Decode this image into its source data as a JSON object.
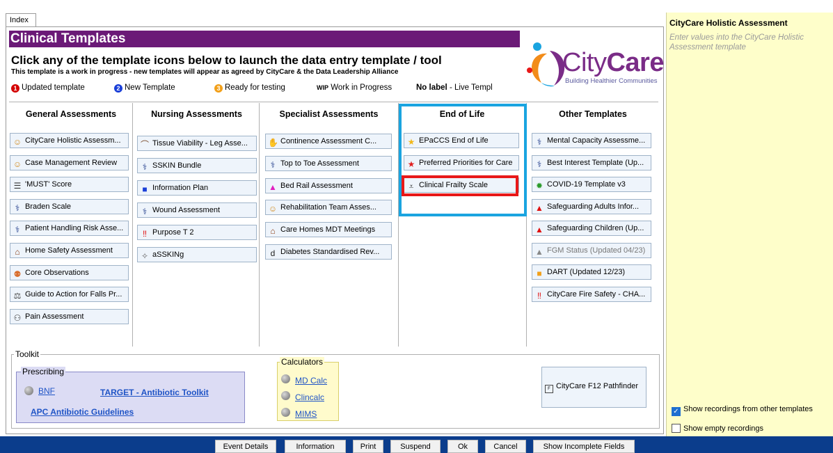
{
  "tab": {
    "label": "Index"
  },
  "header": {
    "title": "Clinical Templates",
    "subtitle": "Click any of the template icons below to launch the data entry template / tool",
    "wip_note": "This template is a work in progress - new templates will appear as agreed by CityCare & the Data Leadership Alliance"
  },
  "legend": {
    "updated": "Updated template",
    "updated_num": "1",
    "new": "New Template",
    "new_num": "2",
    "ready": "Ready for testing",
    "ready_num": "3",
    "wip_tag": "WIP",
    "wip": "Work in Progress",
    "nolabel_tag": "No label",
    "nolabel": "- Live Templ"
  },
  "logo": {
    "brand_light": "City",
    "brand_bold": "Care",
    "tagline": "Building Healthier Communities"
  },
  "columns": {
    "general": {
      "heading": "General Assessments",
      "items": [
        {
          "label": "CityCare Holistic Assessm...",
          "icon": "person-head-icon"
        },
        {
          "label": "Case Management Review",
          "icon": "person-head-icon"
        },
        {
          "label": "'MUST' Score",
          "icon": "stack-icon"
        },
        {
          "label": "Braden Scale",
          "icon": "nurse-icon"
        },
        {
          "label": "Patient Handling Risk Asse...",
          "icon": "nurse-icon"
        },
        {
          "label": "Home Safety Assessment",
          "icon": "house-icon"
        },
        {
          "label": "Core Observations",
          "icon": "people-icon"
        },
        {
          "label": "Guide to Action for Falls Pr...",
          "icon": "scales-icon"
        },
        {
          "label": "Pain Assessment",
          "icon": "figure-icon"
        }
      ]
    },
    "nursing": {
      "heading": "Nursing Assessments",
      "items": [
        {
          "label": "Tissue Viability - Leg Asse...",
          "icon": "leg-icon"
        },
        {
          "label": "SSKIN Bundle",
          "icon": "nurse-icon"
        },
        {
          "label": "Information Plan",
          "icon": "blue-square-icon"
        },
        {
          "label": "Wound Assessment",
          "icon": "nurse-icon"
        },
        {
          "label": "Purpose T 2",
          "icon": "double-exclamation-icon"
        },
        {
          "label": "aSSKINg",
          "icon": "bandage-icon"
        }
      ]
    },
    "specialist": {
      "heading": "Specialist Assessments",
      "items": [
        {
          "label": "Continence Assessment C...",
          "icon": "hand-icon"
        },
        {
          "label": "Top to Toe Assessment",
          "icon": "nurse-icon"
        },
        {
          "label": "Bed Rail Assessment",
          "icon": "pink-triangle-icon"
        },
        {
          "label": "Rehabilitation Team Asses...",
          "icon": "person-head-icon"
        },
        {
          "label": "Care Homes MDT Meetings",
          "icon": "house-icon"
        },
        {
          "label": "Diabetes Standardised Rev...",
          "icon": "letter-d-icon"
        }
      ]
    },
    "eol": {
      "heading": "End of Life",
      "items": [
        {
          "label": "EPaCCS End of Life",
          "icon": "gold-star-icon"
        },
        {
          "label": "Preferred Priorities for Care",
          "icon": "red-star-icon"
        },
        {
          "label": "Clinical Frailty Scale",
          "icon": "walker-icon"
        }
      ]
    },
    "other": {
      "heading": "Other Templates",
      "items": [
        {
          "label": "Mental Capacity Assessme...",
          "icon": "nurse-icon"
        },
        {
          "label": "Best Interest Template (Up...",
          "icon": "nurse-icon"
        },
        {
          "label": "COVID-19 Template v3",
          "icon": "virus-icon"
        },
        {
          "label": "Safeguarding Adults Infor...",
          "icon": "red-triangle-icon"
        },
        {
          "label": "Safeguarding Children (Up...",
          "icon": "red-triangle-icon"
        },
        {
          "label": "FGM Status (Updated 04/23)",
          "icon": "grey-triangle-icon"
        },
        {
          "label": "DART (Updated 12/23)",
          "icon": "orange-square-icon"
        },
        {
          "label": "CityCare Fire Safety - CHA...",
          "icon": "double-exclamation-icon"
        }
      ]
    }
  },
  "toolkit": {
    "label": "Toolkit",
    "prescribing": {
      "label": "Prescribing",
      "bnf": "BNF",
      "target": "TARGET - Antibiotic Toolkit",
      "apc": "APC Antibiotic Guidelines"
    },
    "calculators": {
      "label": "Calculators",
      "items": [
        "MD Calc",
        "Clincalc",
        "MIMS"
      ]
    },
    "pathfinder": "CityCare F12 Pathfinder"
  },
  "right_panel": {
    "title": "CityCare Holistic Assessment",
    "hint": "Enter values into the CityCare Holistic Assessment template",
    "show_other": "Show recordings from other templates",
    "show_other_checked": true,
    "show_empty": "Show empty recordings",
    "show_empty_checked": false
  },
  "footer": {
    "event_details": "Event Details",
    "information": "Information",
    "print": "Print",
    "suspend": "Suspend",
    "ok": "Ok",
    "cancel": "Cancel",
    "show_incomplete": "Show Incomplete Fields"
  },
  "colors": {
    "title_bar": "#6b1a77",
    "eol_highlight": "#1aa4e0",
    "frailty_highlight": "#e81818",
    "right_panel": "#fefeca",
    "bottom_bar": "#0b3d8c"
  }
}
